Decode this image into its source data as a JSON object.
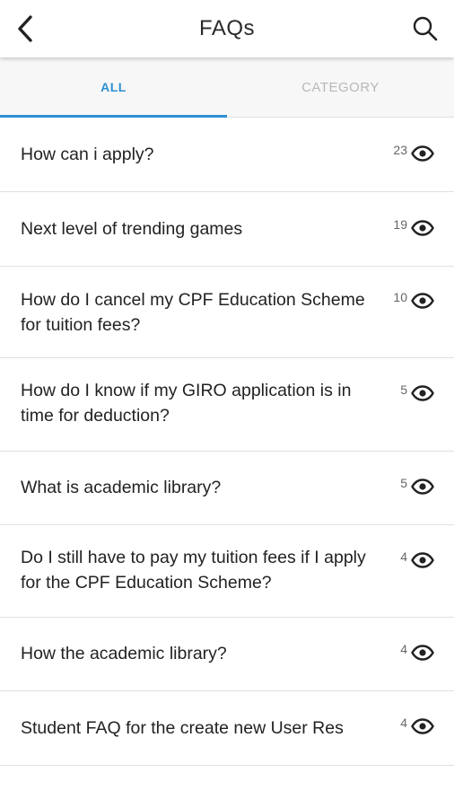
{
  "header": {
    "title": "FAQs",
    "back_icon": "chevron-left-icon",
    "search_icon": "search-icon"
  },
  "tabs": [
    {
      "label": "ALL",
      "active": true
    },
    {
      "label": "CATEGORY",
      "active": false
    }
  ],
  "colors": {
    "accent": "#2f8fd1",
    "inactive_tab": "#b8b8b8"
  },
  "faqs": [
    {
      "question": "How can i apply?",
      "views": "23"
    },
    {
      "question": "Next level of trending games",
      "views": "19"
    },
    {
      "question": "How do I cancel my CPF Education Scheme for tuition fees?",
      "views": "10"
    },
    {
      "question": "How do I know if my GIRO application is in time for deduction?",
      "views": "5"
    },
    {
      "question": "What is academic library?",
      "views": "5"
    },
    {
      "question": "Do I still have to pay my tuition fees if I apply for the CPF Education Scheme?",
      "views": "4"
    },
    {
      "question": "How the academic library?",
      "views": "4"
    },
    {
      "question": "Student FAQ for the create new User Res",
      "views": "4"
    }
  ]
}
